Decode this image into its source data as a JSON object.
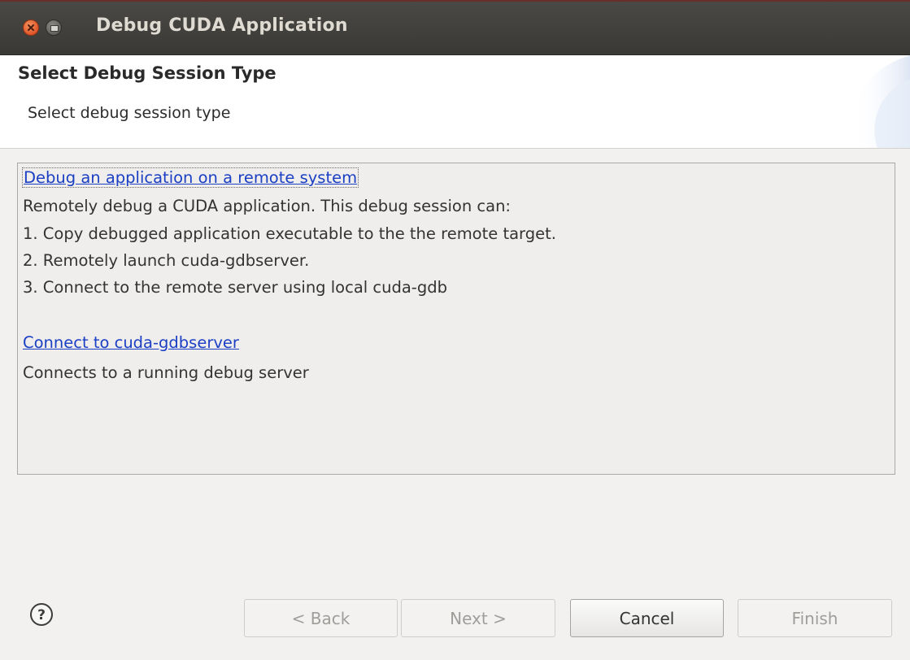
{
  "window": {
    "title": "Debug CUDA Application"
  },
  "header": {
    "heading": "Select Debug Session Type",
    "subtitle": "Select debug session type"
  },
  "options": [
    {
      "link": "Debug an application on a remote system",
      "description": [
        "Remotely debug a CUDA application. This debug session can:",
        "1. Copy debugged application executable to the the remote target.",
        "2. Remotely launch cuda-gdbserver.",
        "3. Connect to the remote server using local cuda-gdb"
      ]
    },
    {
      "link": "Connect to cuda-gdbserver",
      "description": [
        "Connects to a running debug server"
      ]
    }
  ],
  "buttons": {
    "back": "< Back",
    "next": "Next >",
    "cancel": "Cancel",
    "finish": "Finish"
  },
  "icons": {
    "close": "close-icon",
    "minimize": "minimize-icon",
    "help": "help-icon"
  },
  "colors": {
    "titlebar": "#3c3b37",
    "link": "#1b3fc4",
    "close_button": "#e0562a"
  }
}
